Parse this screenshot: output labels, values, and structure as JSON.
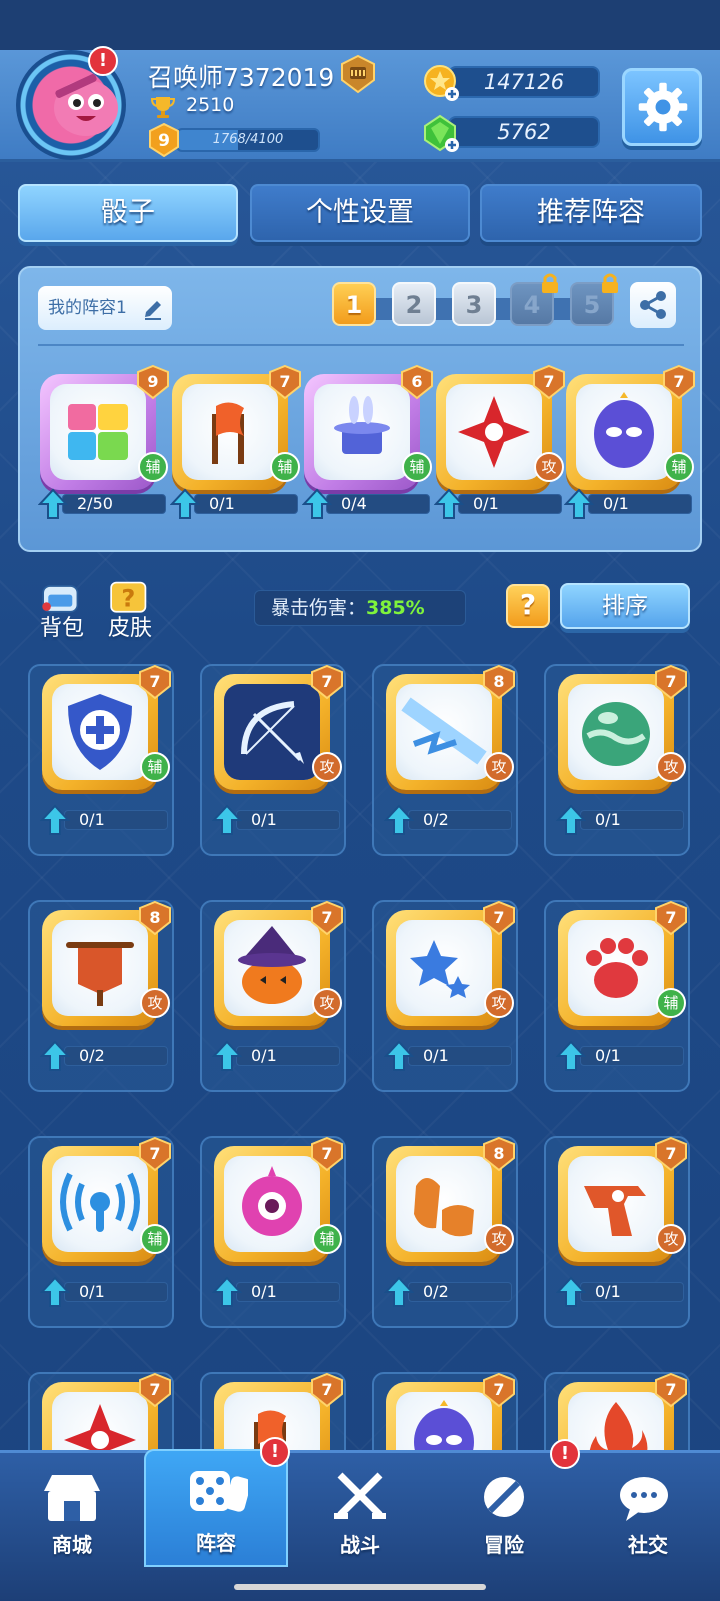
{
  "profile": {
    "username": "召唤师7372019",
    "trophies": "2510",
    "level": "9",
    "exp_text": "1768/4100",
    "exp_progress": 0.43,
    "avatar_alert": "!"
  },
  "currency": {
    "coins": "147126",
    "gems": "5762"
  },
  "tabs": [
    {
      "label": "骰子",
      "active": true
    },
    {
      "label": "个性设置",
      "active": false
    },
    {
      "label": "推荐阵容",
      "active": false
    }
  ],
  "deck": {
    "name": "我的阵容1",
    "slots": [
      {
        "label": "1",
        "state": "active"
      },
      {
        "label": "2",
        "state": "normal"
      },
      {
        "label": "3",
        "state": "normal"
      },
      {
        "label": "4",
        "state": "locked"
      },
      {
        "label": "5",
        "state": "locked"
      }
    ],
    "dice": [
      {
        "icon": "puzzle-dice-icon",
        "level": "9",
        "type": "辅",
        "progress": "2/50",
        "frame": "purple",
        "color": "#f5a0e0"
      },
      {
        "icon": "flag-dice-icon",
        "level": "7",
        "type": "辅",
        "progress": "0/1",
        "frame": "gold",
        "color": "#f0612a"
      },
      {
        "icon": "magic-hat-dice-icon",
        "level": "6",
        "type": "辅",
        "progress": "0/4",
        "frame": "purple",
        "color": "#5263d8"
      },
      {
        "icon": "shuriken-dice-icon",
        "level": "7",
        "type": "攻",
        "progress": "0/1",
        "frame": "gold",
        "color": "#d8262c"
      },
      {
        "icon": "mask-dice-icon",
        "level": "7",
        "type": "辅",
        "progress": "0/1",
        "frame": "gold",
        "color": "#5b4fd6"
      }
    ]
  },
  "middle": {
    "bag_label": "背包",
    "skin_label": "皮肤",
    "crit_label": "暴击伤害：",
    "crit_value": "385%",
    "help_label": "?",
    "sort_label": "排序"
  },
  "collection": [
    {
      "icon": "shield-plus-dice-icon",
      "level": "7",
      "type": "辅",
      "progress": "0/1",
      "color": "#3558c9"
    },
    {
      "icon": "bow-dice-icon",
      "level": "7",
      "type": "攻",
      "progress": "0/1",
      "color": "#1f3a7a"
    },
    {
      "icon": "lightning-dice-icon",
      "level": "8",
      "type": "攻",
      "progress": "0/2",
      "color": "#3d8fe2"
    },
    {
      "icon": "poison-dice-icon",
      "level": "7",
      "type": "攻",
      "progress": "0/1",
      "color": "#3aa57a"
    },
    {
      "icon": "banner-dice-icon",
      "level": "8",
      "type": "攻",
      "progress": "0/2",
      "color": "#d9562a"
    },
    {
      "icon": "pumpkin-dice-icon",
      "level": "7",
      "type": "攻",
      "progress": "0/1",
      "color": "#f07a1e"
    },
    {
      "icon": "star-dice-icon",
      "level": "7",
      "type": "攻",
      "progress": "0/1",
      "color": "#3a7be0"
    },
    {
      "icon": "paw-dice-icon",
      "level": "7",
      "type": "辅",
      "progress": "0/1",
      "color": "#e0393e"
    },
    {
      "icon": "signal-dice-icon",
      "level": "7",
      "type": "辅",
      "progress": "0/1",
      "color": "#2d8fe0"
    },
    {
      "icon": "eye-monster-dice-icon",
      "level": "7",
      "type": "辅",
      "progress": "0/1",
      "color": "#e042b0"
    },
    {
      "icon": "fist-dice-icon",
      "level": "8",
      "type": "攻",
      "progress": "0/2",
      "color": "#e6812a"
    },
    {
      "icon": "gun-dice-icon",
      "level": "7",
      "type": "攻",
      "progress": "0/1",
      "color": "#e0572a"
    },
    {
      "icon": "shuriken-dice-icon",
      "level": "7",
      "type": "",
      "progress": "",
      "color": "#d8262c"
    },
    {
      "icon": "flag-dice-icon",
      "level": "7",
      "type": "",
      "progress": "",
      "color": "#f0612a"
    },
    {
      "icon": "mask-dice-icon",
      "level": "7",
      "type": "",
      "progress": "",
      "color": "#5b4fd6"
    },
    {
      "icon": "fire-dice-icon",
      "level": "7",
      "type": "",
      "progress": "",
      "color": "#e4482a"
    }
  ],
  "nav": [
    {
      "label": "商城",
      "icon": "shop-icon",
      "active": false,
      "alert": ""
    },
    {
      "label": "阵容",
      "icon": "dice-lineup-icon",
      "active": true,
      "alert": "!"
    },
    {
      "label": "战斗",
      "icon": "crossed-swords-icon",
      "active": false,
      "alert": ""
    },
    {
      "label": "冒险",
      "icon": "adventure-icon",
      "active": false,
      "alert": "!"
    },
    {
      "label": "社交",
      "icon": "chat-icon",
      "active": false,
      "alert": ""
    }
  ]
}
